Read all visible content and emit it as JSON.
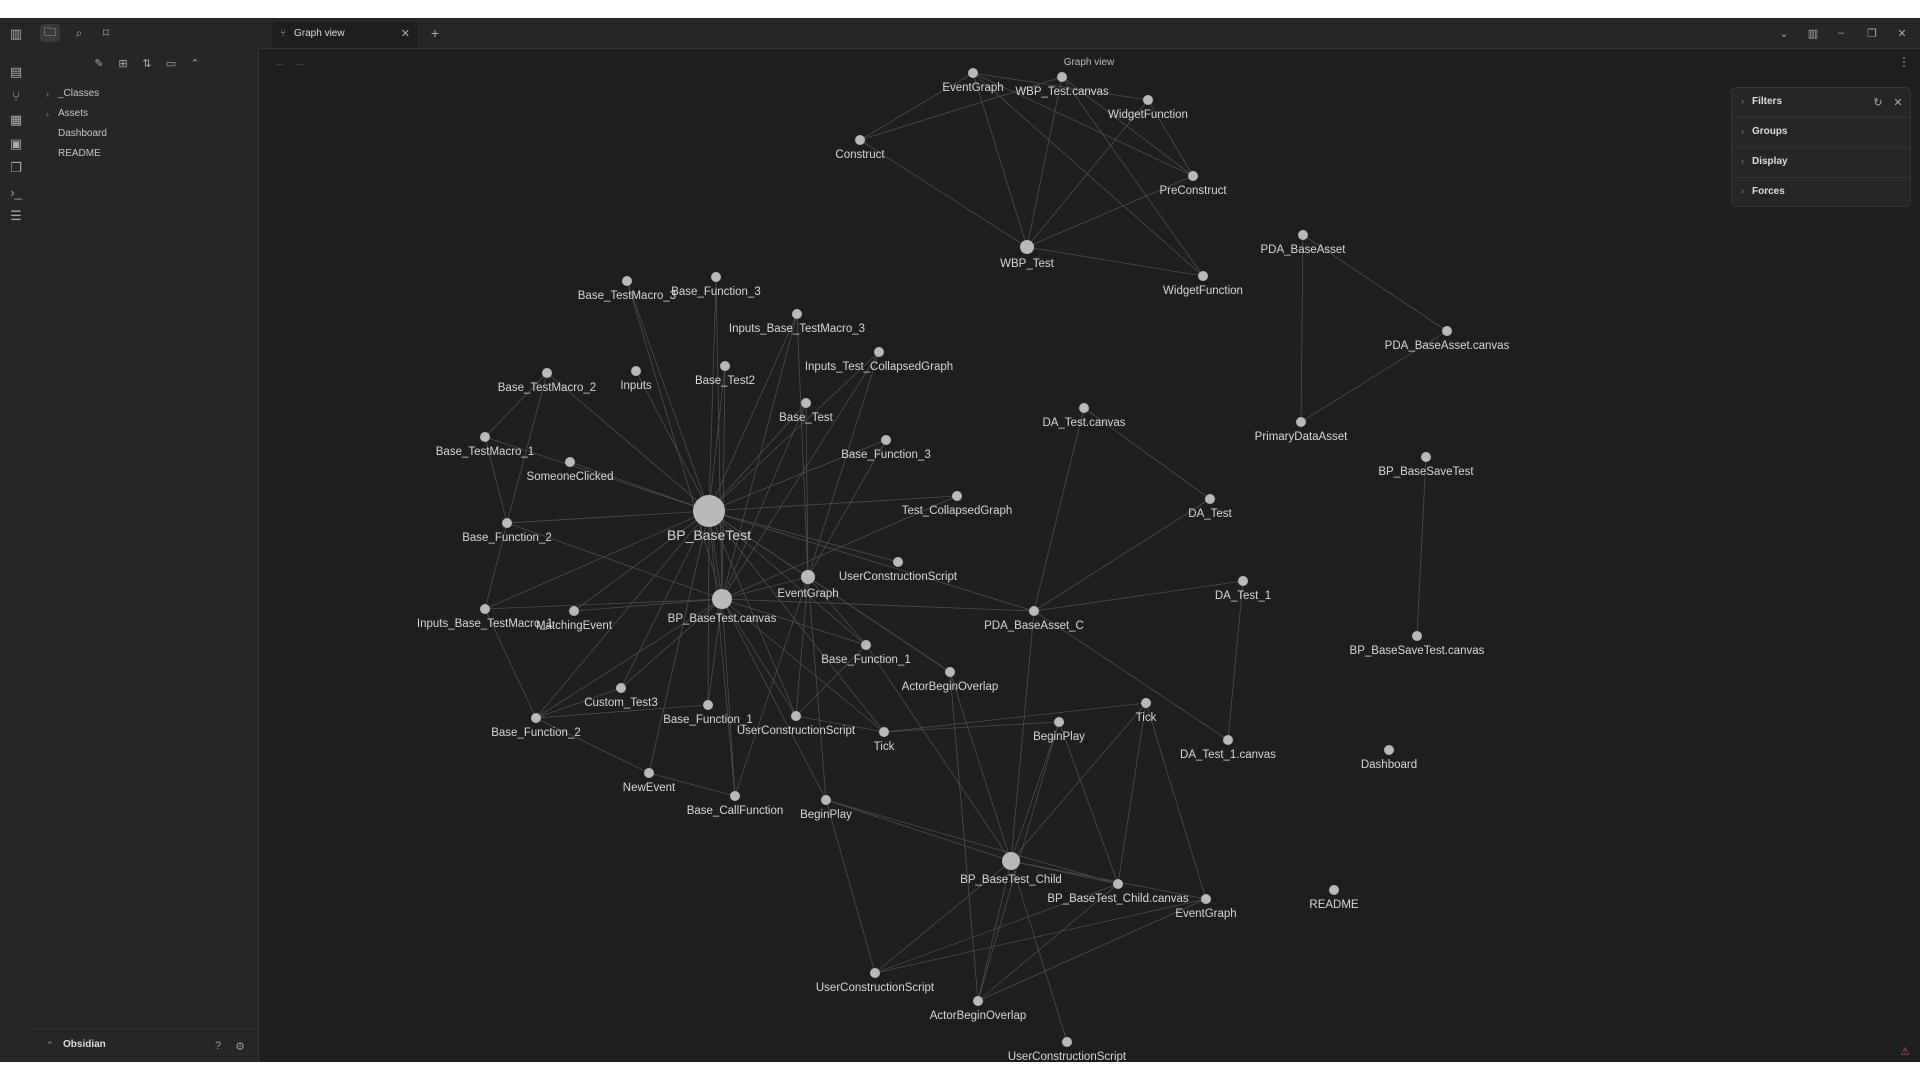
{
  "ribbon": {
    "icons": [
      "sidebar-toggle-icon",
      "new-note-icon",
      "git-branch-icon",
      "grid-icon",
      "calendar-icon",
      "copy-icon",
      "terminal-icon",
      "list-icon"
    ]
  },
  "sidebar": {
    "tree": [
      {
        "label": "_Classes",
        "folder": true
      },
      {
        "label": "Assets",
        "folder": true
      },
      {
        "label": "Dashboard",
        "folder": false
      },
      {
        "label": "README",
        "folder": false
      }
    ],
    "vault_name": "Obsidian"
  },
  "tabs": [
    {
      "label": "Graph view",
      "active": true
    }
  ],
  "view": {
    "title": "Graph view"
  },
  "filters_panel": {
    "sections": [
      "Filters",
      "Groups",
      "Display",
      "Forces"
    ]
  },
  "graph": {
    "nodes": [
      {
        "id": "eg_top",
        "label": "EventGraph"
      },
      {
        "id": "wbp_canvas",
        "label": "WBP_Test.canvas"
      },
      {
        "id": "wf_top",
        "label": "WidgetFunction"
      },
      {
        "id": "construct",
        "label": "Construct"
      },
      {
        "id": "preconstruct",
        "label": "PreConstruct"
      },
      {
        "id": "wbp_test",
        "label": "WBP_Test"
      },
      {
        "id": "wf2",
        "label": "WidgetFunction"
      },
      {
        "id": "pda_base",
        "label": "PDA_BaseAsset"
      },
      {
        "id": "pda_canvas",
        "label": "PDA_BaseAsset.canvas"
      },
      {
        "id": "primary",
        "label": "PrimaryDataAsset"
      },
      {
        "id": "bp_basesave",
        "label": "BP_BaseSaveTest"
      },
      {
        "id": "bp_basesave_c",
        "label": "BP_BaseSaveTest.canvas"
      },
      {
        "id": "da_canvas",
        "label": "DA_Test.canvas"
      },
      {
        "id": "da_test",
        "label": "DA_Test"
      },
      {
        "id": "da_test1",
        "label": "DA_Test_1"
      },
      {
        "id": "da_test1_c",
        "label": "DA_Test_1.canvas"
      },
      {
        "id": "dashboard",
        "label": "Dashboard"
      },
      {
        "id": "readme",
        "label": "README"
      },
      {
        "id": "btm3",
        "label": "Base_TestMacro_3"
      },
      {
        "id": "bf3a",
        "label": "Base_Function_3"
      },
      {
        "id": "ibtm3",
        "label": "Inputs_Base_TestMacro_3"
      },
      {
        "id": "itcg",
        "label": "Inputs_Test_CollapsedGraph"
      },
      {
        "id": "btm2",
        "label": "Base_TestMacro_2"
      },
      {
        "id": "inputs",
        "label": "Inputs"
      },
      {
        "id": "bt2",
        "label": "Base_Test2"
      },
      {
        "id": "base_test",
        "label": "Base_Test"
      },
      {
        "id": "btm1",
        "label": "Base_TestMacro_1"
      },
      {
        "id": "someone",
        "label": "SomeoneClicked"
      },
      {
        "id": "bf3b",
        "label": "Base_Function_3"
      },
      {
        "id": "tcg",
        "label": "Test_CollapsedGraph"
      },
      {
        "id": "bp_basetest",
        "label": "BP_BaseTest"
      },
      {
        "id": "bf2a",
        "label": "Base_Function_2"
      },
      {
        "id": "ucs1",
        "label": "UserConstructionScript"
      },
      {
        "id": "eg_mid",
        "label": "EventGraph"
      },
      {
        "id": "bp_basetest_c",
        "label": "BP_BaseTest.canvas"
      },
      {
        "id": "ibtm",
        "label": "Inputs_Base_TestMacro_1"
      },
      {
        "id": "matching",
        "label": "MatchingEvent"
      },
      {
        "id": "pda_c",
        "label": "PDA_BaseAsset_C"
      },
      {
        "id": "bf1a",
        "label": "Base_Function_1"
      },
      {
        "id": "abo1",
        "label": "ActorBeginOverlap"
      },
      {
        "id": "custom3",
        "label": "Custom_Test3"
      },
      {
        "id": "bf1b",
        "label": "Base_Function_1"
      },
      {
        "id": "ucs2",
        "label": "UserConstructionScript"
      },
      {
        "id": "bf2b",
        "label": "Base_Function_2"
      },
      {
        "id": "tick1",
        "label": "Tick"
      },
      {
        "id": "beginplay1",
        "label": "BeginPlay"
      },
      {
        "id": "tick2",
        "label": "Tick"
      },
      {
        "id": "newevent",
        "label": "NewEvent"
      },
      {
        "id": "callfunc",
        "label": "Base_CallFunction"
      },
      {
        "id": "beginplay2",
        "label": "BeginPlay"
      },
      {
        "id": "bp_child",
        "label": "BP_BaseTest_Child"
      },
      {
        "id": "bp_child_c",
        "label": "BP_BaseTest_Child.canvas"
      },
      {
        "id": "eg_bot",
        "label": "EventGraph"
      },
      {
        "id": "ucs3",
        "label": "UserConstructionScript"
      },
      {
        "id": "abo2",
        "label": "ActorBeginOverlap"
      },
      {
        "id": "ucs4",
        "label": "UserConstructionScript"
      }
    ],
    "links": [
      [
        "eg_top",
        "construct"
      ],
      [
        "eg_top",
        "wbp_test"
      ],
      [
        "eg_top",
        "preconstruct"
      ],
      [
        "eg_top",
        "wf_top"
      ],
      [
        "wbp_canvas",
        "construct"
      ],
      [
        "wbp_canvas",
        "wbp_test"
      ],
      [
        "wbp_canvas",
        "preconstruct"
      ],
      [
        "wbp_canvas",
        "wf2"
      ],
      [
        "wf_top",
        "wbp_test"
      ],
      [
        "wf_top",
        "preconstruct"
      ],
      [
        "construct",
        "wbp_test"
      ],
      [
        "wbp_test",
        "preconstruct"
      ],
      [
        "wbp_test",
        "wf2"
      ],
      [
        "eg_top",
        "wf2"
      ],
      [
        "pda_base",
        "primary"
      ],
      [
        "pda_base",
        "pda_canvas"
      ],
      [
        "pda_canvas",
        "primary"
      ],
      [
        "bp_basesave",
        "bp_basesave_c"
      ],
      [
        "da_canvas",
        "da_test"
      ],
      [
        "da_canvas",
        "pda_c"
      ],
      [
        "da_test",
        "pda_c"
      ],
      [
        "da_test1",
        "pda_c"
      ],
      [
        "da_test1",
        "da_test1_c"
      ],
      [
        "da_test1_c",
        "pda_c"
      ],
      [
        "bp_basetest",
        "btm3"
      ],
      [
        "bp_basetest",
        "bf3a"
      ],
      [
        "bp_basetest",
        "ibtm3"
      ],
      [
        "bp_basetest",
        "itcg"
      ],
      [
        "bp_basetest",
        "btm2"
      ],
      [
        "bp_basetest",
        "inputs"
      ],
      [
        "bp_basetest",
        "bt2"
      ],
      [
        "bp_basetest",
        "base_test"
      ],
      [
        "bp_basetest",
        "btm1"
      ],
      [
        "bp_basetest",
        "someone"
      ],
      [
        "bp_basetest",
        "bf3b"
      ],
      [
        "bp_basetest",
        "tcg"
      ],
      [
        "bp_basetest",
        "bf2a"
      ],
      [
        "bp_basetest",
        "ucs1"
      ],
      [
        "bp_basetest",
        "eg_mid"
      ],
      [
        "bp_basetest",
        "bp_basetest_c"
      ],
      [
        "bp_basetest",
        "ibtm"
      ],
      [
        "bp_basetest",
        "matching"
      ],
      [
        "bp_basetest",
        "pda_c"
      ],
      [
        "bp_basetest",
        "bf1a"
      ],
      [
        "bp_basetest",
        "custom3"
      ],
      [
        "bp_basetest",
        "bf1b"
      ],
      [
        "bp_basetest",
        "ucs2"
      ],
      [
        "bp_basetest",
        "bf2b"
      ],
      [
        "bp_basetest",
        "tick1"
      ],
      [
        "bp_basetest",
        "newevent"
      ],
      [
        "bp_basetest",
        "callfunc"
      ],
      [
        "bp_basetest",
        "abo1"
      ],
      [
        "bp_basetest_c",
        "btm3"
      ],
      [
        "bp_basetest_c",
        "bf3a"
      ],
      [
        "bp_basetest_c",
        "ibtm3"
      ],
      [
        "bp_basetest_c",
        "itcg"
      ],
      [
        "bp_basetest_c",
        "bt2"
      ],
      [
        "bp_basetest_c",
        "base_test"
      ],
      [
        "bp_basetest_c",
        "tcg"
      ],
      [
        "bp_basetest_c",
        "bf2a"
      ],
      [
        "bp_basetest_c",
        "eg_mid"
      ],
      [
        "bp_basetest_c",
        "ibtm"
      ],
      [
        "bp_basetest_c",
        "matching"
      ],
      [
        "bp_basetest_c",
        "bf1a"
      ],
      [
        "bp_basetest_c",
        "custom3"
      ],
      [
        "bp_basetest_c",
        "bf1b"
      ],
      [
        "bp_basetest_c",
        "ucs2"
      ],
      [
        "bp_basetest_c",
        "bf2b"
      ],
      [
        "bp_basetest_c",
        "tick1"
      ],
      [
        "bp_basetest_c",
        "callfunc"
      ],
      [
        "bp_basetest_c",
        "beginplay2"
      ],
      [
        "bp_basetest_c",
        "pda_c"
      ],
      [
        "eg_mid",
        "ibtm3"
      ],
      [
        "eg_mid",
        "itcg"
      ],
      [
        "eg_mid",
        "base_test"
      ],
      [
        "eg_mid",
        "bf3b"
      ],
      [
        "eg_mid",
        "ucs2"
      ],
      [
        "eg_mid",
        "beginplay2"
      ],
      [
        "eg_mid",
        "bf1a"
      ],
      [
        "eg_mid",
        "callfunc"
      ],
      [
        "eg_mid",
        "abo1"
      ],
      [
        "btm2",
        "bf2a"
      ],
      [
        "btm2",
        "btm1"
      ],
      [
        "btm1",
        "bf2a"
      ],
      [
        "bf2a",
        "ibtm"
      ],
      [
        "ibtm",
        "bf2b"
      ],
      [
        "bf2b",
        "newevent"
      ],
      [
        "newevent",
        "callfunc"
      ],
      [
        "bf1b",
        "bf2b"
      ],
      [
        "custom3",
        "bf2b"
      ],
      [
        "tick1",
        "ucs2"
      ],
      [
        "ucs2",
        "bf1a"
      ],
      [
        "pda_c",
        "bp_child"
      ],
      [
        "bp_child",
        "beginplay1"
      ],
      [
        "bp_child",
        "tick2"
      ],
      [
        "bp_child",
        "bp_child_c"
      ],
      [
        "bp_child",
        "eg_bot"
      ],
      [
        "bp_child",
        "ucs3"
      ],
      [
        "bp_child",
        "abo2"
      ],
      [
        "bp_child",
        "ucs4"
      ],
      [
        "bp_child",
        "beginplay2"
      ],
      [
        "bp_child",
        "abo1"
      ],
      [
        "bp_child",
        "bf1a"
      ],
      [
        "bp_child_c",
        "beginplay1"
      ],
      [
        "bp_child_c",
        "tick2"
      ],
      [
        "bp_child_c",
        "ucs3"
      ],
      [
        "bp_child_c",
        "abo2"
      ],
      [
        "bp_child_c",
        "beginplay2"
      ],
      [
        "eg_bot",
        "abo2"
      ],
      [
        "eg_bot",
        "tick2"
      ],
      [
        "eg_bot",
        "ucs3"
      ],
      [
        "beginplay1",
        "tick1"
      ],
      [
        "beginplay1",
        "abo2"
      ],
      [
        "tick2",
        "tick1"
      ],
      [
        "abo1",
        "abo2"
      ],
      [
        "beginplay2",
        "ucs3"
      ]
    ]
  }
}
